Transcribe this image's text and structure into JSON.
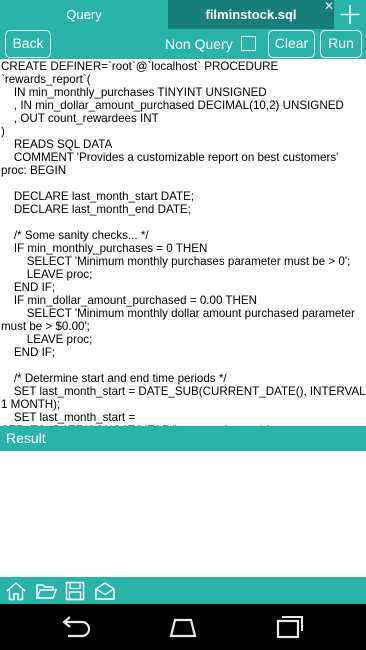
{
  "tabs": {
    "query_label": "Query",
    "file_label": "filminstock.sql",
    "close_glyph": "✕",
    "add_icon": "plus-icon"
  },
  "toolbar": {
    "back_label": "Back",
    "non_query_label": "Non Query",
    "non_query_checked": false,
    "clear_label": "Clear",
    "run_label": "Run"
  },
  "editor": {
    "lines": [
      "CREATE DEFINER=`root`@`localhost` PROCEDURE `rewards_report`(",
      "    IN min_monthly_purchases TINYINT UNSIGNED",
      "    , IN min_dollar_amount_purchased DECIMAL(10,2) UNSIGNED",
      "    , OUT count_rewardees INT",
      ")",
      "    READS SQL DATA",
      "    COMMENT 'Provides a customizable report on best customers'",
      "proc: BEGIN",
      "",
      "    DECLARE last_month_start DATE;",
      "    DECLARE last_month_end DATE;",
      "",
      "    /* Some sanity checks... */",
      "    IF min_monthly_purchases = 0 THEN",
      "        SELECT 'Minimum monthly purchases parameter must be > 0';",
      "        LEAVE proc;",
      "    END IF;",
      "    IF min_dollar_amount_purchased = 0.00 THEN",
      "        SELECT 'Minimum monthly dollar amount purchased parameter must be > $0.00';",
      "        LEAVE proc;",
      "    END IF;",
      "",
      "    /* Determine start and end time periods */",
      "    SET last_month_start = DATE_SUB(CURRENT_DATE(), INTERVAL 1 MONTH);",
      "    SET last_month_start =",
      "STR_TO_DATE(CONCAT(YEAR(last_month_start),'-"
    ]
  },
  "result": {
    "label": "Result"
  },
  "bottom_toolbar": {
    "icons": [
      "home-icon",
      "folder-open-icon",
      "save-icon",
      "mail-icon"
    ]
  },
  "nav": {
    "icons": [
      "back-icon",
      "home-icon",
      "recent-apps-icon"
    ]
  },
  "colors": {
    "accent": "#2ab3a8",
    "active_tab": "#177e7a",
    "navbar": "#000000"
  }
}
